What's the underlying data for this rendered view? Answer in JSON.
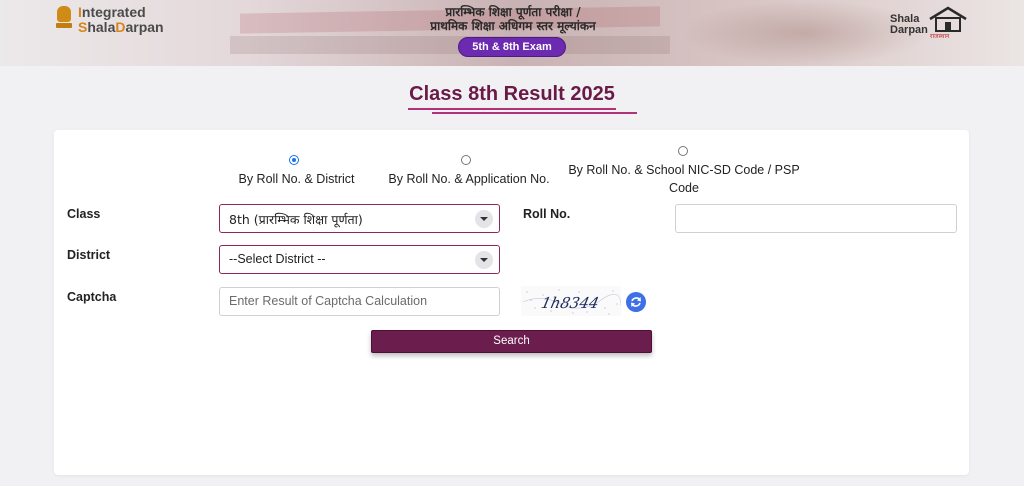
{
  "header": {
    "brand_line1_accent": "I",
    "brand_line1_rest": "ntegrated",
    "brand_line2_accent": "S",
    "brand_line2_rest": "hala",
    "brand_line2_accent2": "D",
    "brand_line2_rest2": "arpan",
    "hindi_title_line1": "प्रारम्भिक शिक्षा पूर्णता परीक्षा /",
    "hindi_title_line2": "प्राथमिक शिक्षा अधिगम स्तर मूल्यांकन",
    "exam_badge": "5th & 8th Exam",
    "right_logo_line1": "Shala",
    "right_logo_line2": "Darpan",
    "right_logo_tagline": "राजस्थान",
    "colors": {
      "brand_orange": "#d9841a",
      "pill_purple": "#6b2ab0",
      "maroon": "#6a1a47"
    }
  },
  "page": {
    "title": "Class 8th Result 2025"
  },
  "form": {
    "search_modes": [
      {
        "label": "By Roll No. & District",
        "checked": true
      },
      {
        "label": "By Roll No. & Application No.",
        "checked": false
      },
      {
        "label": "By Roll No. & School NIC-SD Code / PSP Code",
        "checked": false
      }
    ],
    "class_label": "Class",
    "class_value": "8th (प्रारम्भिक शिक्षा पूर्णता)",
    "roll_label": "Roll No.",
    "roll_value": "",
    "district_label": "District",
    "district_value": "--Select District --",
    "captcha_label": "Captcha",
    "captcha_placeholder": "Enter Result of Captcha Calculation",
    "captcha_text": "1h8344",
    "search_button": "Search"
  }
}
